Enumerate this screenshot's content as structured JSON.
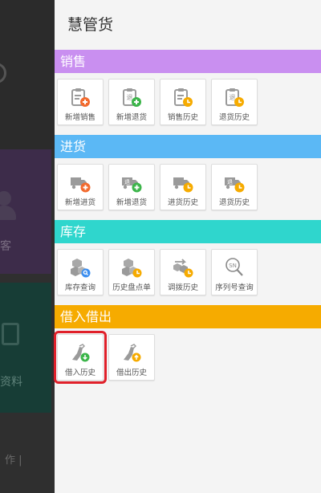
{
  "background": {
    "purple_card_text": "客",
    "green_card_text": "资料",
    "bottom_text": "作 |"
  },
  "drawer": {
    "title": "慧管货",
    "sections": [
      {
        "title": "销售",
        "color": "#c98ff0",
        "items": [
          {
            "label": "新增销售",
            "icon": "clipboard-add-icon"
          },
          {
            "label": "新增退货",
            "icon": "return-add-icon"
          },
          {
            "label": "销售历史",
            "icon": "clipboard-history-icon"
          },
          {
            "label": "退货历史",
            "icon": "return-history-icon"
          }
        ]
      },
      {
        "title": "进货",
        "color": "#5bb8f5",
        "items": [
          {
            "label": "新增进货",
            "icon": "truck-add-icon"
          },
          {
            "label": "新增退货",
            "icon": "truck-return-add-icon"
          },
          {
            "label": "进货历史",
            "icon": "truck-history-icon"
          },
          {
            "label": "退货历史",
            "icon": "truck-return-history-icon"
          }
        ]
      },
      {
        "title": "库存",
        "color": "#2fd6cd",
        "items": [
          {
            "label": "库存查询",
            "icon": "boxes-search-icon"
          },
          {
            "label": "历史盘点单",
            "icon": "boxes-history-icon"
          },
          {
            "label": "调拨历史",
            "icon": "transfer-history-icon"
          },
          {
            "label": "序列号查询",
            "icon": "serial-search-icon"
          }
        ]
      },
      {
        "title": "借入借出",
        "color": "#f6ab00",
        "items": [
          {
            "label": "借入历史",
            "icon": "borrow-in-icon"
          },
          {
            "label": "借出历史",
            "icon": "borrow-out-icon"
          }
        ]
      }
    ]
  },
  "colors": {
    "icon_grey": "#9a9a9a",
    "badge_orange": "#f26a2e",
    "badge_green": "#3cb54a",
    "badge_yellow": "#f6ab00",
    "badge_blue": "#3b8ef0",
    "highlight_red": "#e0202a"
  }
}
